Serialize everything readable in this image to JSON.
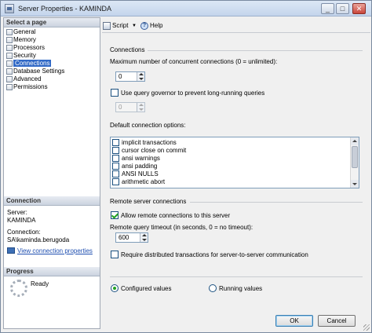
{
  "window": {
    "title": "Server Properties - KAMINDA",
    "minimize": "_",
    "maximize": "□",
    "close": "✕"
  },
  "left": {
    "select_header": "Select a page",
    "pages": [
      "General",
      "Memory",
      "Processors",
      "Security",
      "Connections",
      "Database Settings",
      "Advanced",
      "Permissions"
    ],
    "selected_page": "Connections",
    "connection_header": "Connection",
    "server_label": "Server:",
    "server_value": "KAMINDA",
    "connection_label": "Connection:",
    "connection_value": "SA\\kaminda.berugoda",
    "view_link": "View connection properties",
    "progress_header": "Progress",
    "progress_status": "Ready"
  },
  "toolbar": {
    "script_label": "Script",
    "script_dropdown": "▼",
    "help_label": "Help",
    "help_glyph": "?"
  },
  "connections": {
    "section": "Connections",
    "max_label": "Maximum number of concurrent connections (0 = unlimited):",
    "max_value": "0",
    "governor_label": "Use query governor to prevent long-running queries",
    "governor_checked": false,
    "governor_value": "0",
    "default_label": "Default connection options:",
    "options": [
      "implicit transactions",
      "cursor close on commit",
      "ansi warnings",
      "ansi padding",
      "ANSI NULLS",
      "arithmetic abort"
    ]
  },
  "remote": {
    "section": "Remote server connections",
    "allow_label": "Allow remote connections to this server",
    "allow_checked": true,
    "timeout_label": "Remote query timeout (in seconds, 0 = no timeout):",
    "timeout_value": "600",
    "distributed_label": "Require distributed transactions for server-to-server communication",
    "distributed_checked": false
  },
  "view_mode": {
    "configured": "Configured values",
    "running": "Running values",
    "selected": "configured"
  },
  "buttons": {
    "ok": "OK",
    "cancel": "Cancel"
  }
}
